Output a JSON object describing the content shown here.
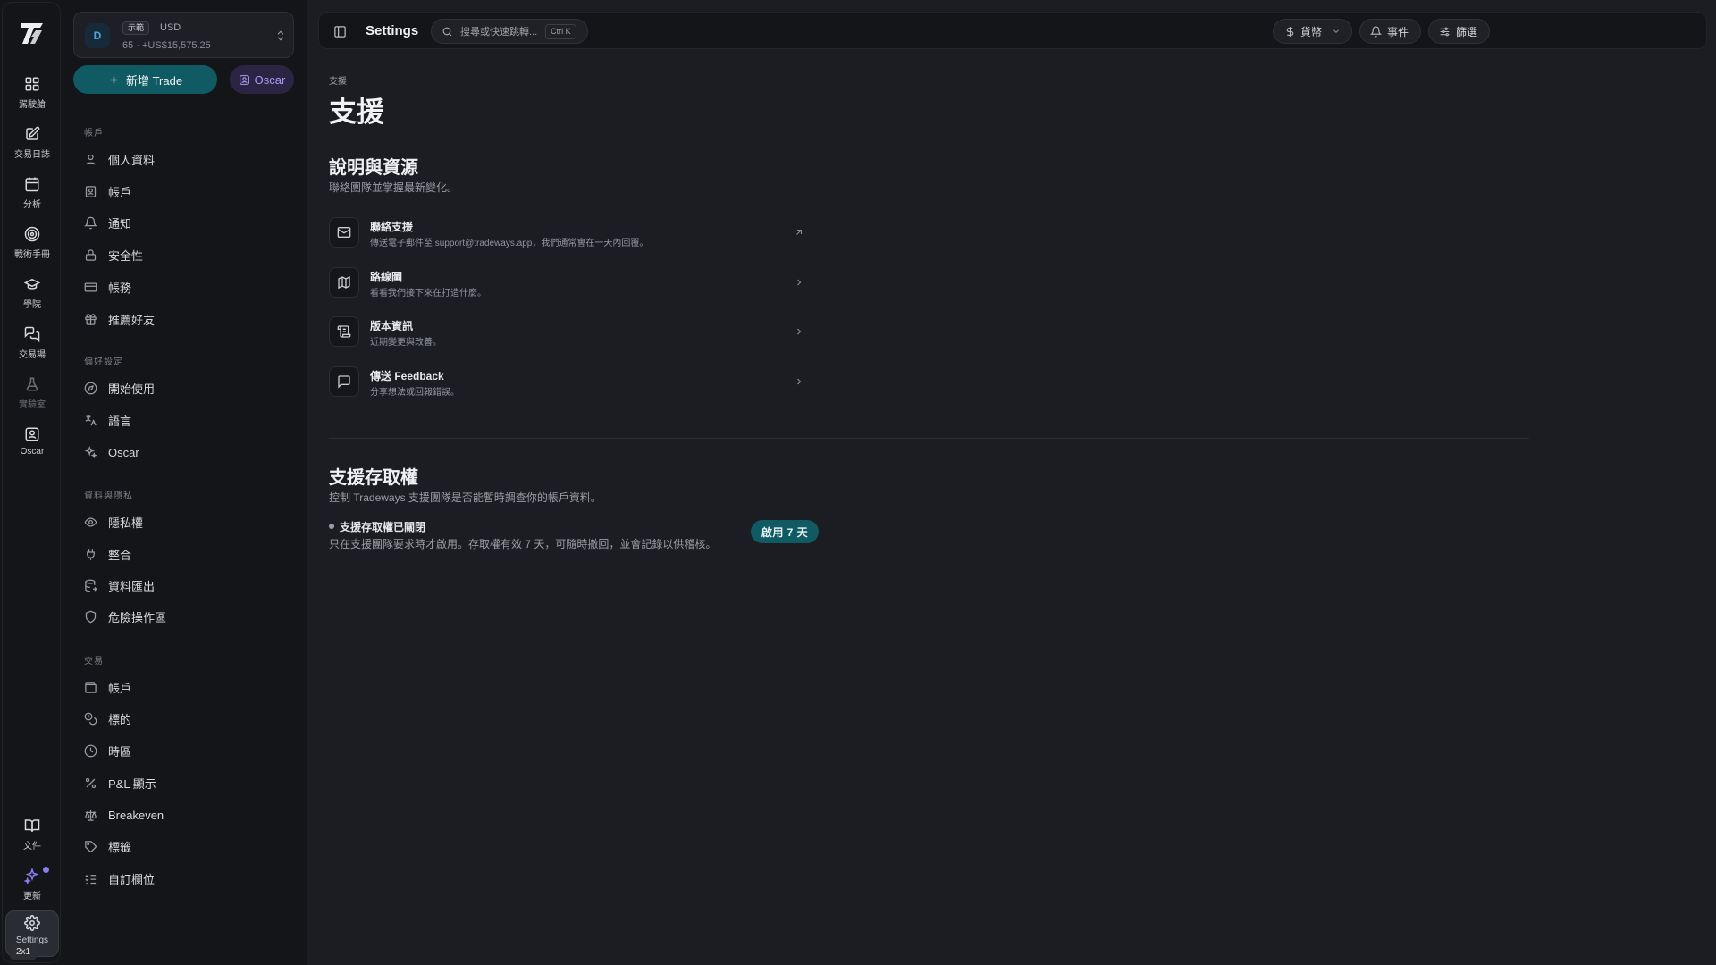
{
  "rail": {
    "items": [
      {
        "label": "駕駛艙",
        "icon": "layout-grid-icon"
      },
      {
        "label": "交易日誌",
        "icon": "journal-edit-icon"
      },
      {
        "label": "分析",
        "icon": "calendar-icon"
      },
      {
        "label": "戰術手冊",
        "icon": "target-icon"
      },
      {
        "label": "學院",
        "icon": "graduation-cap-icon"
      },
      {
        "label": "交易場",
        "icon": "chat-bubbles-icon"
      },
      {
        "label": "實驗室",
        "icon": "flask-icon"
      },
      {
        "label": "Oscar",
        "icon": "oscar-icon"
      }
    ],
    "bottom_items": [
      {
        "label": "文件",
        "icon": "book-icon"
      },
      {
        "label": "更新",
        "icon": "sparkle-icon"
      },
      {
        "label": "Settings",
        "icon": "gear-icon"
      }
    ],
    "badge": "2x1"
  },
  "account": {
    "avatar": "D",
    "demo_tag": "示範",
    "currency": "USD",
    "subtitle": "65 · +US$15,575.25"
  },
  "actions": {
    "new_trade": "新增 Trade",
    "oscar": "Oscar"
  },
  "nav": {
    "sections": [
      {
        "title": "帳戶",
        "items": [
          {
            "label": "個人資料",
            "icon": "user-icon"
          },
          {
            "label": "帳戶",
            "icon": "id-card-icon"
          },
          {
            "label": "通知",
            "icon": "bell-icon"
          },
          {
            "label": "安全性",
            "icon": "lock-icon"
          },
          {
            "label": "帳務",
            "icon": "credit-card-icon"
          },
          {
            "label": "推薦好友",
            "icon": "gift-icon"
          }
        ]
      },
      {
        "title": "偏好設定",
        "items": [
          {
            "label": "開始使用",
            "icon": "compass-icon"
          },
          {
            "label": "語言",
            "icon": "translate-icon"
          },
          {
            "label": "Oscar",
            "icon": "sparkles-icon"
          }
        ]
      },
      {
        "title": "資料與隱私",
        "items": [
          {
            "label": "隱私權",
            "icon": "eye-icon"
          },
          {
            "label": "整合",
            "icon": "plug-icon"
          },
          {
            "label": "資料匯出",
            "icon": "database-export-icon"
          },
          {
            "label": "危險操作區",
            "icon": "shield-icon"
          }
        ]
      },
      {
        "title": "交易",
        "items": [
          {
            "label": "帳戶",
            "icon": "wallet-icon"
          },
          {
            "label": "標的",
            "icon": "coins-icon"
          },
          {
            "label": "時區",
            "icon": "clock-icon"
          },
          {
            "label": "P&L 顯示",
            "icon": "percent-icon"
          },
          {
            "label": "Breakeven",
            "icon": "scale-icon"
          },
          {
            "label": "標籤",
            "icon": "tag-icon"
          },
          {
            "label": "自訂欄位",
            "icon": "list-checks-icon"
          }
        ]
      }
    ]
  },
  "topbar": {
    "title": "Settings",
    "search_placeholder": "搜尋或快速跳轉...",
    "search_shortcut": "Ctrl K",
    "currency_label": "貨幣",
    "events_label": "事件",
    "filter_label": "篩選"
  },
  "page": {
    "breadcrumb": "支援",
    "title": "支援",
    "help": {
      "heading": "說明與資源",
      "subtitle": "聯絡團隊並掌握最新變化。",
      "rows": [
        {
          "title": "聯絡支援",
          "desc": "傳送電子郵件至 support@tradeways.app，我們通常會在一天內回覆。",
          "icon": "mail-icon",
          "arrow": "external-link-icon"
        },
        {
          "title": "路線圖",
          "desc": "看看我們接下來在打造什麼。",
          "icon": "map-icon",
          "arrow": "chevron-right-icon"
        },
        {
          "title": "版本資訊",
          "desc": "近期變更與改善。",
          "icon": "scroll-icon",
          "arrow": "chevron-right-icon"
        },
        {
          "title": "傳送 Feedback",
          "desc": "分享想法或回報錯誤。",
          "icon": "message-square-icon",
          "arrow": "chevron-right-icon"
        }
      ]
    },
    "access": {
      "heading": "支援存取權",
      "subtitle": "控制 Tradeways 支援團隊是否能暫時調查你的帳戶資料。",
      "status": "支援存取權已關閉",
      "desc": "只在支援團隊要求時才啟用。存取權有效 7 天，可隨時撤回，並會記錄以供稽核。",
      "button": "啟用 7 天"
    }
  }
}
